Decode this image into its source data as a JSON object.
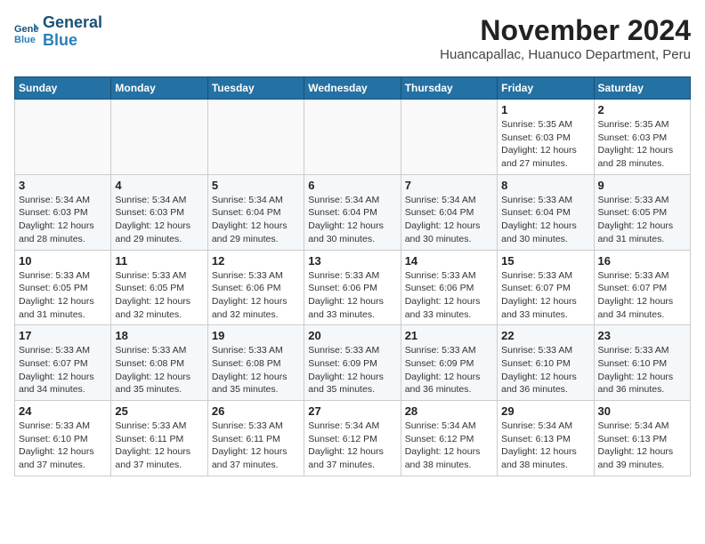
{
  "header": {
    "logo_line1": "General",
    "logo_line2": "Blue",
    "month_title": "November 2024",
    "subtitle": "Huancapallac, Huanuco Department, Peru"
  },
  "weekdays": [
    "Sunday",
    "Monday",
    "Tuesday",
    "Wednesday",
    "Thursday",
    "Friday",
    "Saturday"
  ],
  "weeks": [
    [
      {
        "day": "",
        "info": ""
      },
      {
        "day": "",
        "info": ""
      },
      {
        "day": "",
        "info": ""
      },
      {
        "day": "",
        "info": ""
      },
      {
        "day": "",
        "info": ""
      },
      {
        "day": "1",
        "info": "Sunrise: 5:35 AM\nSunset: 6:03 PM\nDaylight: 12 hours and 27 minutes."
      },
      {
        "day": "2",
        "info": "Sunrise: 5:35 AM\nSunset: 6:03 PM\nDaylight: 12 hours and 28 minutes."
      }
    ],
    [
      {
        "day": "3",
        "info": "Sunrise: 5:34 AM\nSunset: 6:03 PM\nDaylight: 12 hours and 28 minutes."
      },
      {
        "day": "4",
        "info": "Sunrise: 5:34 AM\nSunset: 6:03 PM\nDaylight: 12 hours and 29 minutes."
      },
      {
        "day": "5",
        "info": "Sunrise: 5:34 AM\nSunset: 6:04 PM\nDaylight: 12 hours and 29 minutes."
      },
      {
        "day": "6",
        "info": "Sunrise: 5:34 AM\nSunset: 6:04 PM\nDaylight: 12 hours and 30 minutes."
      },
      {
        "day": "7",
        "info": "Sunrise: 5:34 AM\nSunset: 6:04 PM\nDaylight: 12 hours and 30 minutes."
      },
      {
        "day": "8",
        "info": "Sunrise: 5:33 AM\nSunset: 6:04 PM\nDaylight: 12 hours and 30 minutes."
      },
      {
        "day": "9",
        "info": "Sunrise: 5:33 AM\nSunset: 6:05 PM\nDaylight: 12 hours and 31 minutes."
      }
    ],
    [
      {
        "day": "10",
        "info": "Sunrise: 5:33 AM\nSunset: 6:05 PM\nDaylight: 12 hours and 31 minutes."
      },
      {
        "day": "11",
        "info": "Sunrise: 5:33 AM\nSunset: 6:05 PM\nDaylight: 12 hours and 32 minutes."
      },
      {
        "day": "12",
        "info": "Sunrise: 5:33 AM\nSunset: 6:06 PM\nDaylight: 12 hours and 32 minutes."
      },
      {
        "day": "13",
        "info": "Sunrise: 5:33 AM\nSunset: 6:06 PM\nDaylight: 12 hours and 33 minutes."
      },
      {
        "day": "14",
        "info": "Sunrise: 5:33 AM\nSunset: 6:06 PM\nDaylight: 12 hours and 33 minutes."
      },
      {
        "day": "15",
        "info": "Sunrise: 5:33 AM\nSunset: 6:07 PM\nDaylight: 12 hours and 33 minutes."
      },
      {
        "day": "16",
        "info": "Sunrise: 5:33 AM\nSunset: 6:07 PM\nDaylight: 12 hours and 34 minutes."
      }
    ],
    [
      {
        "day": "17",
        "info": "Sunrise: 5:33 AM\nSunset: 6:07 PM\nDaylight: 12 hours and 34 minutes."
      },
      {
        "day": "18",
        "info": "Sunrise: 5:33 AM\nSunset: 6:08 PM\nDaylight: 12 hours and 35 minutes."
      },
      {
        "day": "19",
        "info": "Sunrise: 5:33 AM\nSunset: 6:08 PM\nDaylight: 12 hours and 35 minutes."
      },
      {
        "day": "20",
        "info": "Sunrise: 5:33 AM\nSunset: 6:09 PM\nDaylight: 12 hours and 35 minutes."
      },
      {
        "day": "21",
        "info": "Sunrise: 5:33 AM\nSunset: 6:09 PM\nDaylight: 12 hours and 36 minutes."
      },
      {
        "day": "22",
        "info": "Sunrise: 5:33 AM\nSunset: 6:10 PM\nDaylight: 12 hours and 36 minutes."
      },
      {
        "day": "23",
        "info": "Sunrise: 5:33 AM\nSunset: 6:10 PM\nDaylight: 12 hours and 36 minutes."
      }
    ],
    [
      {
        "day": "24",
        "info": "Sunrise: 5:33 AM\nSunset: 6:10 PM\nDaylight: 12 hours and 37 minutes."
      },
      {
        "day": "25",
        "info": "Sunrise: 5:33 AM\nSunset: 6:11 PM\nDaylight: 12 hours and 37 minutes."
      },
      {
        "day": "26",
        "info": "Sunrise: 5:33 AM\nSunset: 6:11 PM\nDaylight: 12 hours and 37 minutes."
      },
      {
        "day": "27",
        "info": "Sunrise: 5:34 AM\nSunset: 6:12 PM\nDaylight: 12 hours and 37 minutes."
      },
      {
        "day": "28",
        "info": "Sunrise: 5:34 AM\nSunset: 6:12 PM\nDaylight: 12 hours and 38 minutes."
      },
      {
        "day": "29",
        "info": "Sunrise: 5:34 AM\nSunset: 6:13 PM\nDaylight: 12 hours and 38 minutes."
      },
      {
        "day": "30",
        "info": "Sunrise: 5:34 AM\nSunset: 6:13 PM\nDaylight: 12 hours and 39 minutes."
      }
    ]
  ]
}
